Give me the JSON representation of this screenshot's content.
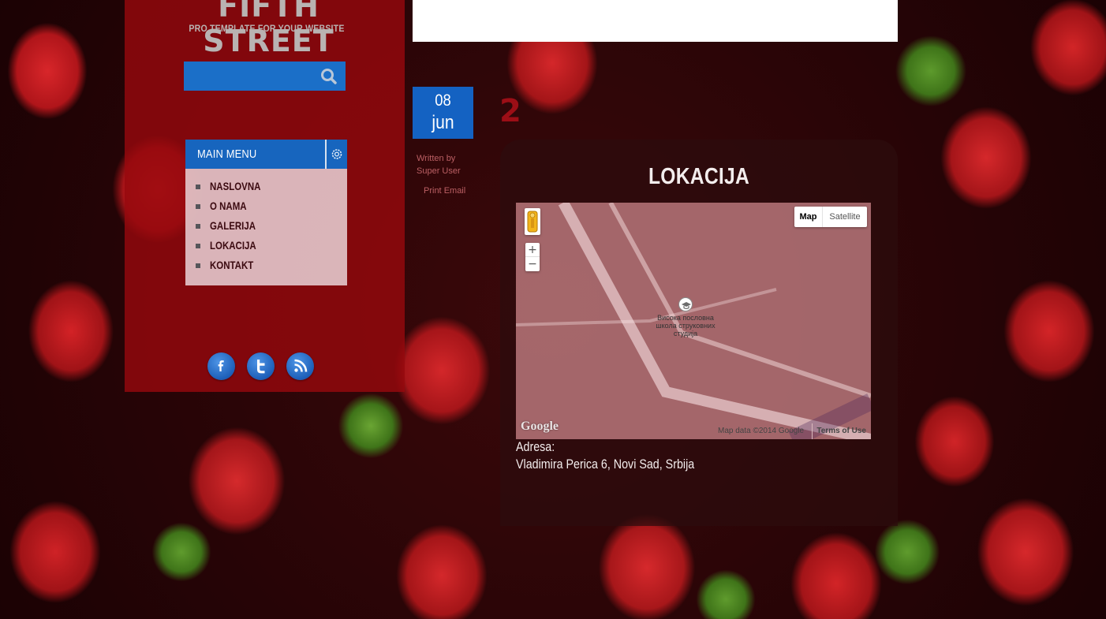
{
  "site": {
    "logo_title": "FIFTH STREET",
    "logo_subtitle": "PRO TEMPLATE FOR YOUR WEBSITE"
  },
  "search": {
    "placeholder": "",
    "icon": "search-icon"
  },
  "menu": {
    "title": "MAIN MENU",
    "toggle_icon": "gear-icon",
    "items": [
      {
        "label": "NASLOVNA"
      },
      {
        "label": "O NAMA"
      },
      {
        "label": "GALERIJA"
      },
      {
        "label": "LOKACIJA"
      },
      {
        "label": "KONTAKT"
      }
    ]
  },
  "social": [
    {
      "icon": "facebook-icon"
    },
    {
      "icon": "twitter-icon"
    },
    {
      "icon": "rss-icon"
    }
  ],
  "article": {
    "date_day": "08",
    "date_month": "jun",
    "hits": "2",
    "written_by": "Written by",
    "author": "Super User",
    "print": "Print",
    "email": "Email",
    "title": "LOKACIJA",
    "address_label": "Adresa:",
    "address_value": "Vladimira Perica 6, Novi Sad, Srbija"
  },
  "map": {
    "type_map": "Map",
    "type_satellite": "Satellite",
    "zoom_in": "+",
    "zoom_out": "−",
    "poi_label": "Висока пословна школа струковних студија",
    "google_logo": "Google",
    "attribution": "Map data ©2014 Google",
    "terms": "Terms of Use"
  },
  "colors": {
    "accent_blue": "#1765be",
    "panel_red": "#96080e",
    "menu_text": "#3b0a10"
  }
}
